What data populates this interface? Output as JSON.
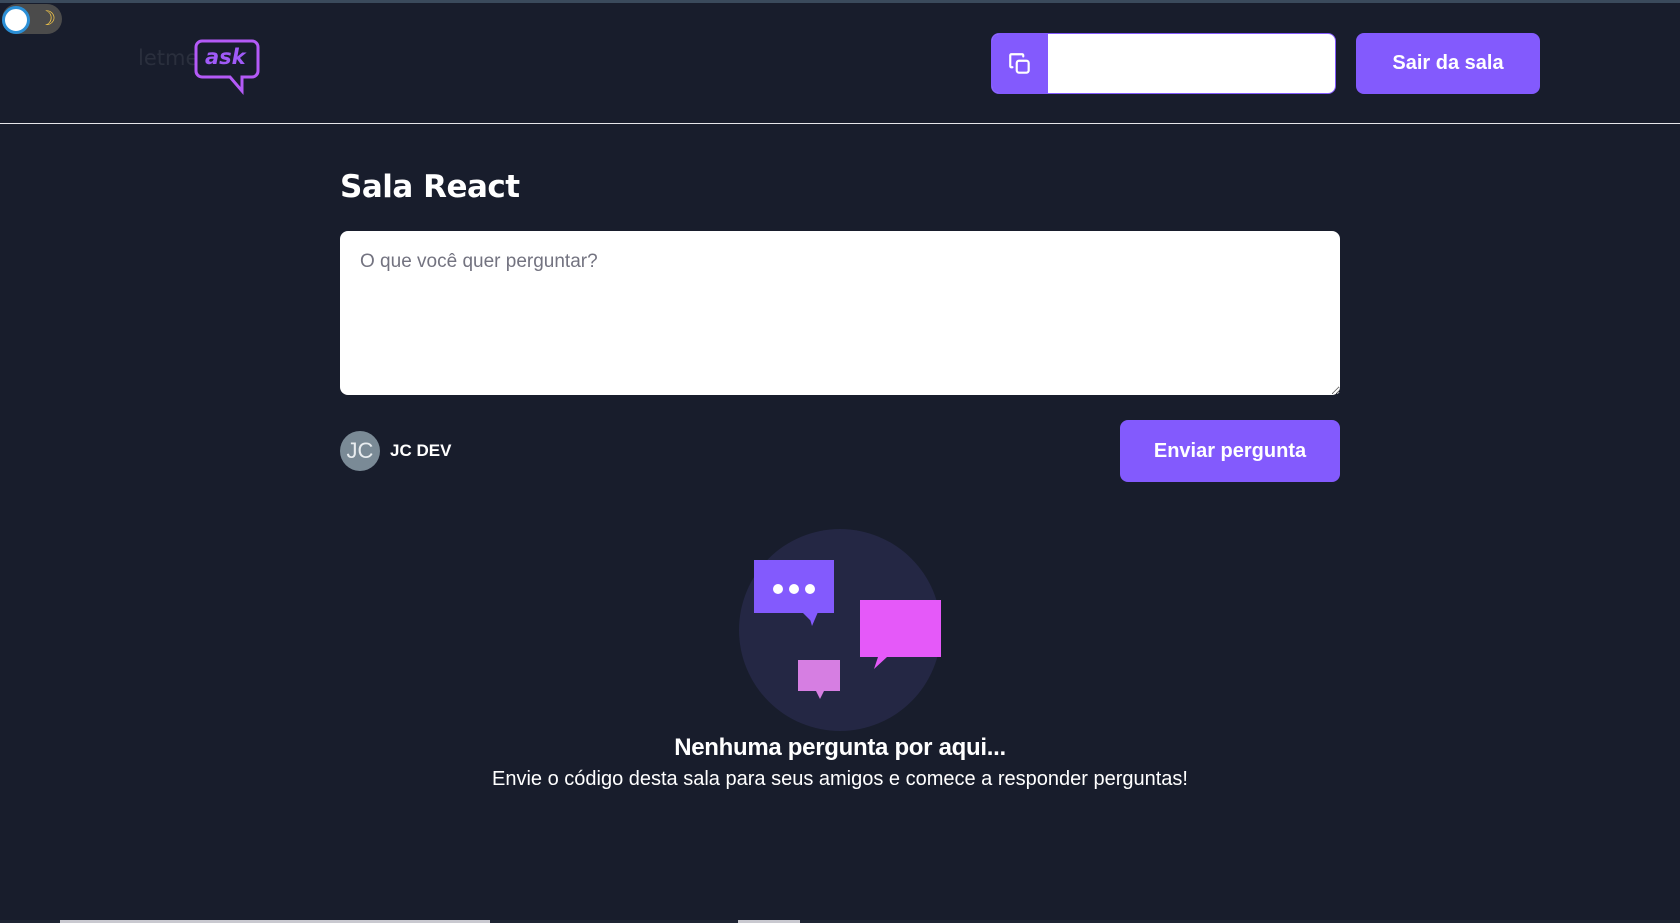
{
  "theme_toggle": {
    "icon": "moon-icon",
    "state": "dark"
  },
  "header": {
    "logo": {
      "part1": "letme",
      "part2": "ask"
    },
    "room_code": {
      "icon": "copy-icon",
      "text": ""
    },
    "leave_label": "Sair da sala"
  },
  "room": {
    "title": "Sala React",
    "question_placeholder": "O que você quer perguntar?",
    "question_value": "",
    "user": {
      "initials": "JC",
      "name": "JC DEV"
    },
    "send_label": "Enviar pergunta"
  },
  "empty_state": {
    "title": "Nenhuma pergunta por aqui...",
    "description": "Envie o código desta sala para seus amigos e comece a responder perguntas!"
  },
  "colors": {
    "background": "#181d2c",
    "accent": "#835afd",
    "pink": "#e559f9",
    "light_pink": "#d67ee2",
    "illustration_bg": "#242744"
  }
}
